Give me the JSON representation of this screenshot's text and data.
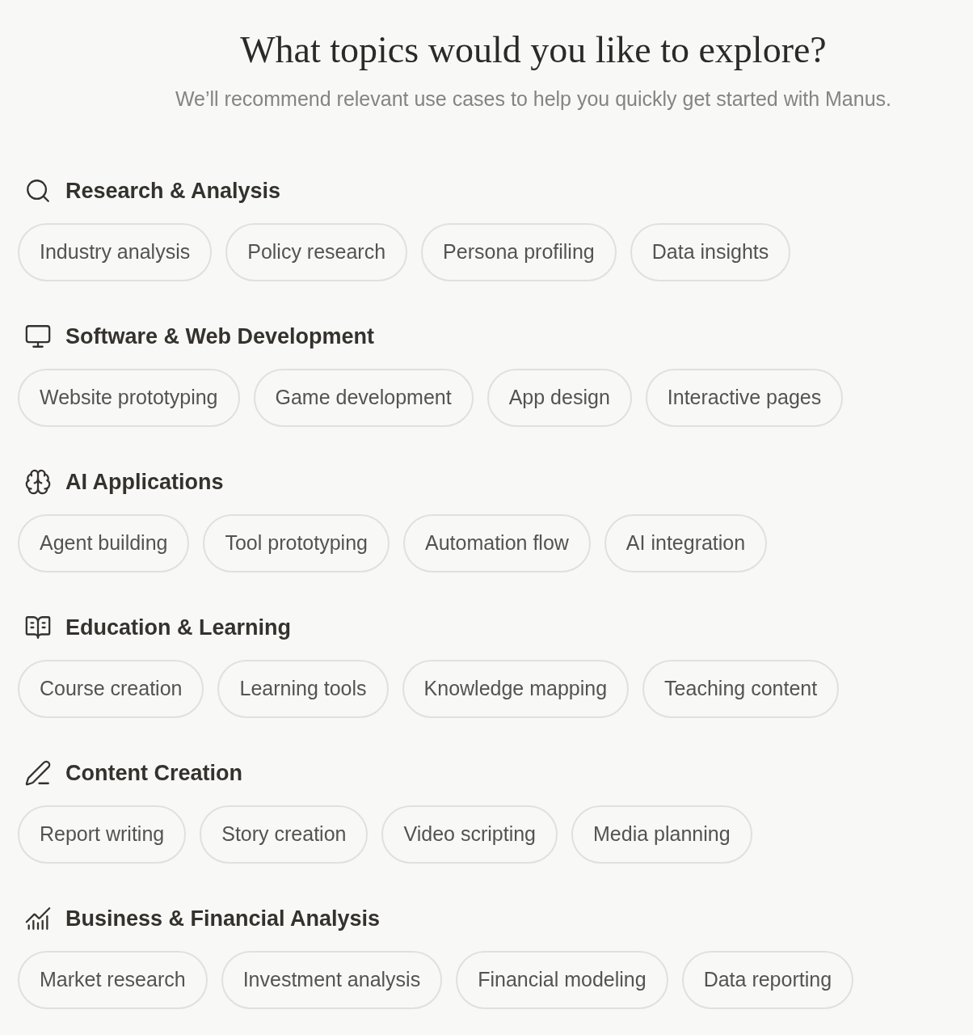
{
  "header": {
    "title": "What topics would you like to explore?",
    "subtitle": "We’ll recommend relevant use cases to help you quickly get started with Manus."
  },
  "sections": [
    {
      "title": "Research & Analysis",
      "topics": [
        "Industry analysis",
        "Policy research",
        "Persona profiling",
        "Data insights"
      ]
    },
    {
      "title": "Software & Web Development",
      "topics": [
        "Website prototyping",
        "Game development",
        "App design",
        "Interactive pages"
      ]
    },
    {
      "title": "AI Applications",
      "topics": [
        "Agent building",
        "Tool prototyping",
        "Automation flow",
        "AI integration"
      ]
    },
    {
      "title": "Education & Learning",
      "topics": [
        "Course creation",
        "Learning tools",
        "Knowledge mapping",
        "Teaching content"
      ]
    },
    {
      "title": "Content Creation",
      "topics": [
        "Report writing",
        "Story creation",
        "Video scripting",
        "Media planning"
      ]
    },
    {
      "title": "Business & Financial Analysis",
      "topics": [
        "Market research",
        "Investment analysis",
        "Financial modeling",
        "Data reporting"
      ]
    }
  ]
}
